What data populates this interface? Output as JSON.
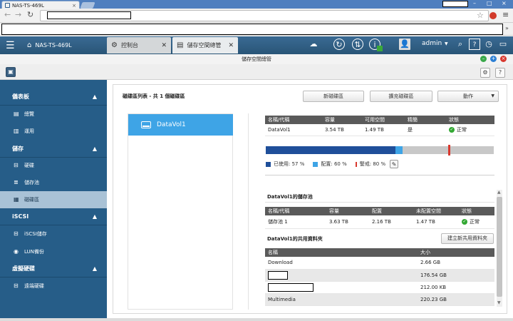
{
  "browser": {
    "tab_title": "NAS-TS-469L",
    "tab_close": "×"
  },
  "app": {
    "tabs": [
      {
        "label": "NAS-TS-469L"
      },
      {
        "label": "控制台"
      },
      {
        "label": "儲存空間總管"
      }
    ],
    "user": "admin",
    "window_title": "儲存空間總管"
  },
  "sidebar": {
    "sections": [
      {
        "label": "儀表板",
        "items": [
          "總覽",
          "運用"
        ]
      },
      {
        "label": "儲存",
        "items": [
          "硬碟",
          "儲存池",
          "磁碟區"
        ]
      },
      {
        "label": "iSCSI",
        "items": [
          "iSCSI儲存",
          "LUN備份"
        ]
      },
      {
        "label": "虛擬硬碟",
        "items": [
          "遠端硬碟"
        ]
      }
    ],
    "active_item": "磁碟區"
  },
  "main": {
    "caption": "磁碟區列表 - 共 1 個磁碟區",
    "buttons": {
      "new_volume": "新磁碟區",
      "expand_volume": "擴充磁碟區",
      "action": "動作"
    },
    "volume_name": "DataVol1",
    "summary_table": {
      "headers": [
        "名稱/代稱",
        "容量",
        "可用空間",
        "精簡",
        "狀態"
      ],
      "row": [
        "DataVol1",
        "3.54 TB",
        "1.49 TB",
        "是",
        "正常"
      ]
    },
    "usage": {
      "used_pct": 57,
      "allocated_pct": 60,
      "alert_pct": 80,
      "used_label": "已使用: 57 %",
      "allocated_label": "配置: 60 %",
      "alert_label": "警戒: 80 %"
    },
    "colors": {
      "used": "#1f4f9a",
      "allocated": "#3ea4e6",
      "alert": "#d9382e",
      "free": "#c8c8c8"
    },
    "pool_section_title": "DataVol1的儲存池",
    "pool_table": {
      "headers": [
        "名稱/代稱",
        "容量",
        "配置",
        "未配置空間",
        "狀態"
      ],
      "row": [
        "儲存池 1",
        "3.63 TB",
        "2.16 TB",
        "1.47 TB",
        "正常"
      ]
    },
    "share_section_title": "DataVol1的共用資料夾",
    "new_share_button": "建立新共用資料夾",
    "share_table": {
      "headers": [
        "名稱",
        "大小"
      ],
      "rows": [
        {
          "name": "Download",
          "size": "2.66 GB"
        },
        {
          "name": "",
          "size": "176.54 GB"
        },
        {
          "name": "",
          "size": "212.00 KB"
        },
        {
          "name": "Multimedia",
          "size": "220.23 GB"
        }
      ]
    }
  }
}
